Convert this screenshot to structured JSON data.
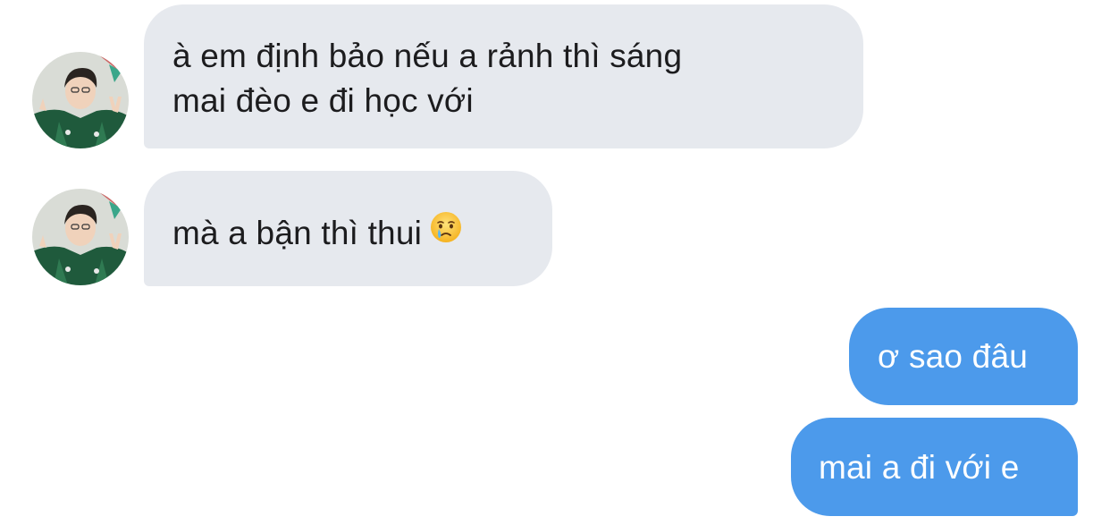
{
  "conversation": {
    "messages": [
      {
        "direction": "incoming",
        "lines": [
          "à em định bảo nếu a rảnh thì sáng",
          "mai đèo e đi học với"
        ],
        "avatar_icon": "avatar-photo"
      },
      {
        "direction": "incoming",
        "text": "mà a bận thì thui",
        "emoji_icon": "crying-face-emoji-icon",
        "avatar_icon": "avatar-photo"
      },
      {
        "direction": "outgoing",
        "text": "ơ sao đâu"
      },
      {
        "direction": "outgoing",
        "text": "mai a đi với e"
      }
    ]
  },
  "colors": {
    "incoming_bubble": "#e6e9ee",
    "outgoing_bubble": "#4c9aeb",
    "incoming_text": "#1c1c1e",
    "outgoing_text": "#ffffff",
    "background": "#ffffff"
  }
}
